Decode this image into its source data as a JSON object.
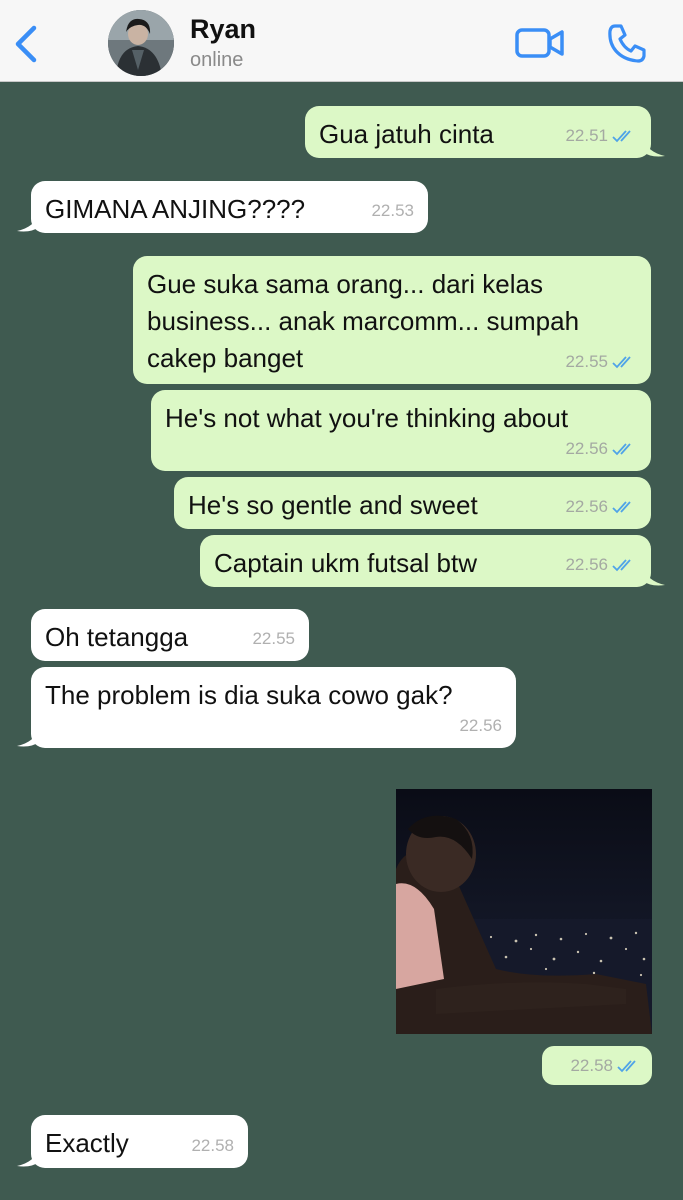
{
  "header": {
    "back_icon": "chevron-left-icon",
    "contact_name": "Ryan",
    "contact_status": "online",
    "video_icon": "video-camera-icon",
    "call_icon": "phone-icon",
    "accent_color": "#3a8ef6"
  },
  "chat": {
    "background_color": "#3f5a50",
    "outgoing_color": "#dcf8c6",
    "incoming_color": "#ffffff",
    "messages": [
      {
        "direction": "out",
        "text": "Gua jatuh cinta",
        "time": "22.51",
        "read": true
      },
      {
        "direction": "in",
        "text": "GIMANA ANJING????",
        "time": "22.53"
      },
      {
        "direction": "out",
        "text": "Gue suka sama orang... dari kelas\nbusiness... anak marcomm... sumpah\ncakep banget",
        "time": "22.55",
        "read": true
      },
      {
        "direction": "out",
        "text": "He's not what you're thinking about",
        "time": "22.56",
        "read": true
      },
      {
        "direction": "out",
        "text": "He's so gentle and sweet",
        "time": "22.56",
        "read": true
      },
      {
        "direction": "out",
        "text": "Captain ukm futsal btw",
        "time": "22.56",
        "read": true
      },
      {
        "direction": "in",
        "text": "Oh tetangga",
        "time": "22.55"
      },
      {
        "direction": "in",
        "text": "The problem is dia suka cowo gak?",
        "time": "22.56"
      },
      {
        "direction": "out",
        "type": "image",
        "time": "22.58",
        "read": true
      },
      {
        "direction": "in",
        "text": "Exactly",
        "time": "22.58"
      }
    ]
  }
}
